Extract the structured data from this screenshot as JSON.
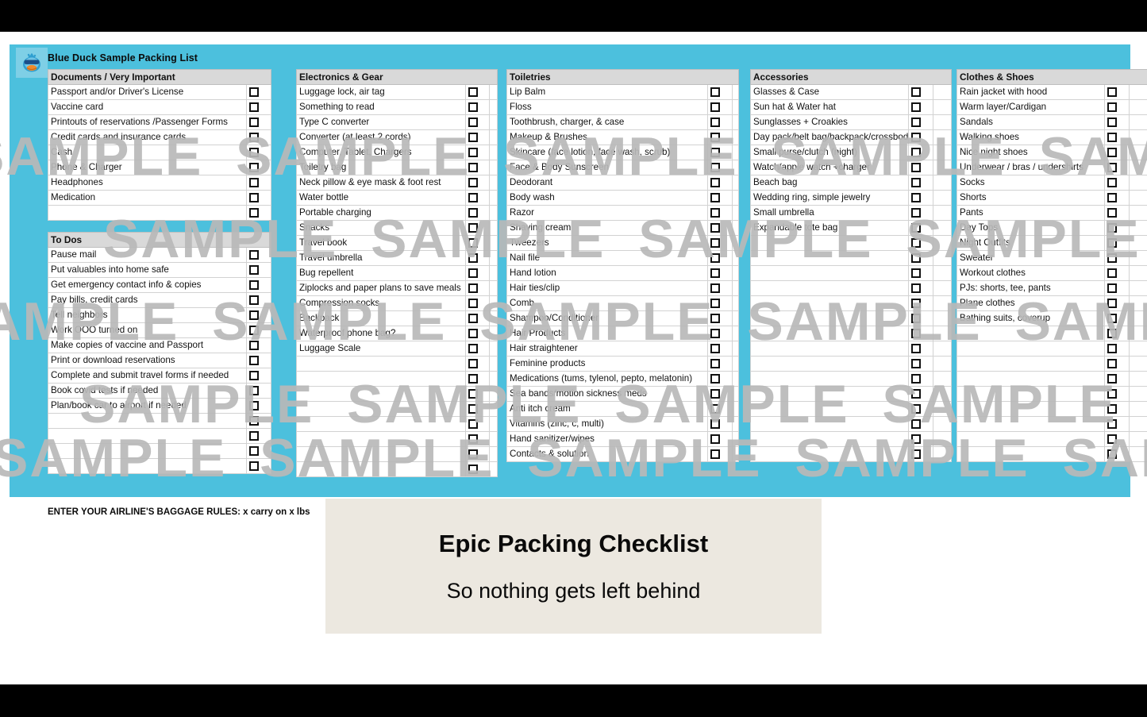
{
  "header": {
    "title": "Blue Duck Sample Packing List",
    "logo_icon": "duck-with-sunglasses-icon",
    "band_color": "#4cc0dd"
  },
  "watermark": {
    "text": "SAMPLE",
    "color": "#b9b9b9"
  },
  "footer_note": "ENTER YOUR AIRLINE'S BAGGAGE RULES: x carry on x lbs",
  "overlay": {
    "title": "Epic Packing Checklist",
    "subtitle": "So nothing gets left behind",
    "background": "#ece8e0"
  },
  "columns": [
    {
      "id": "documents",
      "tables": [
        {
          "heading": "Documents / Very Important",
          "items": [
            "Passport and/or Driver's License",
            "Vaccine card",
            "Printouts of reservations /Passenger Forms",
            "Credit cards and insurance cards",
            "Cash",
            "Phone & Charger",
            "Headphones",
            "Medication",
            ""
          ]
        },
        {
          "heading": "To Dos",
          "items": [
            "Pause mail",
            "Put valuables into home safe",
            "Get emergency contact info & copies",
            "Pay bills, credit cards",
            "Tell neighbors",
            "Work OOO turned on",
            "Make copies of vaccine and Passport",
            "Print or download reservations",
            "Complete and submit travel forms if needed",
            "Book covid tests if needed",
            "Plan/book car to airport if needed",
            "",
            "",
            "",
            ""
          ]
        }
      ]
    },
    {
      "id": "electronics",
      "tables": [
        {
          "heading": "Electronics & Gear",
          "items": [
            "Luggage lock, air tag",
            "Something to read",
            "Type C converter",
            "Converter (at least 2 cords)",
            "Computer, Tablet, Chargers",
            "Toiletry bag",
            "Neck pillow & eye mask & foot rest",
            "Water bottle",
            "Portable charging",
            "Snacks",
            "Travel book",
            "Travel umbrella",
            "Bug repellent",
            "Ziplocks and paper plans to save meals",
            "Compression socks",
            "Backpack",
            "Waterproof phone bag?",
            "Luggage Scale",
            "",
            "",
            "",
            "",
            "",
            "",
            "",
            ""
          ]
        }
      ]
    },
    {
      "id": "toiletries",
      "tables": [
        {
          "heading": "Toiletries",
          "items": [
            "Lip Balm",
            "Floss",
            "Toothbrush, charger, & case",
            "Makeup & Brushes",
            "Skincare (face lotion, face wash, scrub)",
            "Face & Body Sunscreen",
            "Deodorant",
            "Body wash",
            "Razor",
            "Shaving cream",
            "Tweezers",
            "Nail file",
            "Hand lotion",
            "Hair ties/clip",
            "Comb",
            "Shampoo/Conditioner",
            "Hair Products",
            "Hair straightener",
            "Feminine products",
            "Medications (tums, tylenol, pepto, melatonin)",
            "Sea bands/motion sickness meds",
            "Anti itch cream",
            "Vitamins (zinc, c, multi)",
            "Hand sanitizer/wipes",
            "Contacts & solution"
          ]
        }
      ]
    },
    {
      "id": "accessories",
      "tables": [
        {
          "heading": "Accessories",
          "items": [
            "Glasses & Case",
            "Sun hat & Water hat",
            "Sunglasses + Croakies",
            "Day pack/belt bag/backpack/crossbody",
            "Small purse/clutch (night)",
            "Watch/apple watch +charger",
            "Beach bag",
            "Wedding ring, simple jewelry",
            "Small umbrella",
            "Expandable tote bag",
            "",
            "",
            "",
            "",
            "",
            "",
            "",
            "",
            "",
            "",
            "",
            "",
            "",
            "",
            ""
          ]
        }
      ]
    },
    {
      "id": "clothes",
      "tables": [
        {
          "heading": "Clothes & Shoes",
          "items": [
            "Rain jacket with hood",
            "Warm layer/Cardigan",
            "Sandals",
            "Walking shoes",
            "Nice night shoes",
            "Underwear / bras / undershirts",
            "Socks",
            "Shorts",
            "Pants",
            "Day Tops",
            "Night Outfits",
            "Sweater",
            "Workout clothes",
            "PJs: shorts, tee, pants",
            "Plane clothes",
            "Bathing suits, coverup",
            "",
            "",
            "",
            "",
            "",
            "",
            "",
            "",
            ""
          ]
        }
      ]
    }
  ]
}
